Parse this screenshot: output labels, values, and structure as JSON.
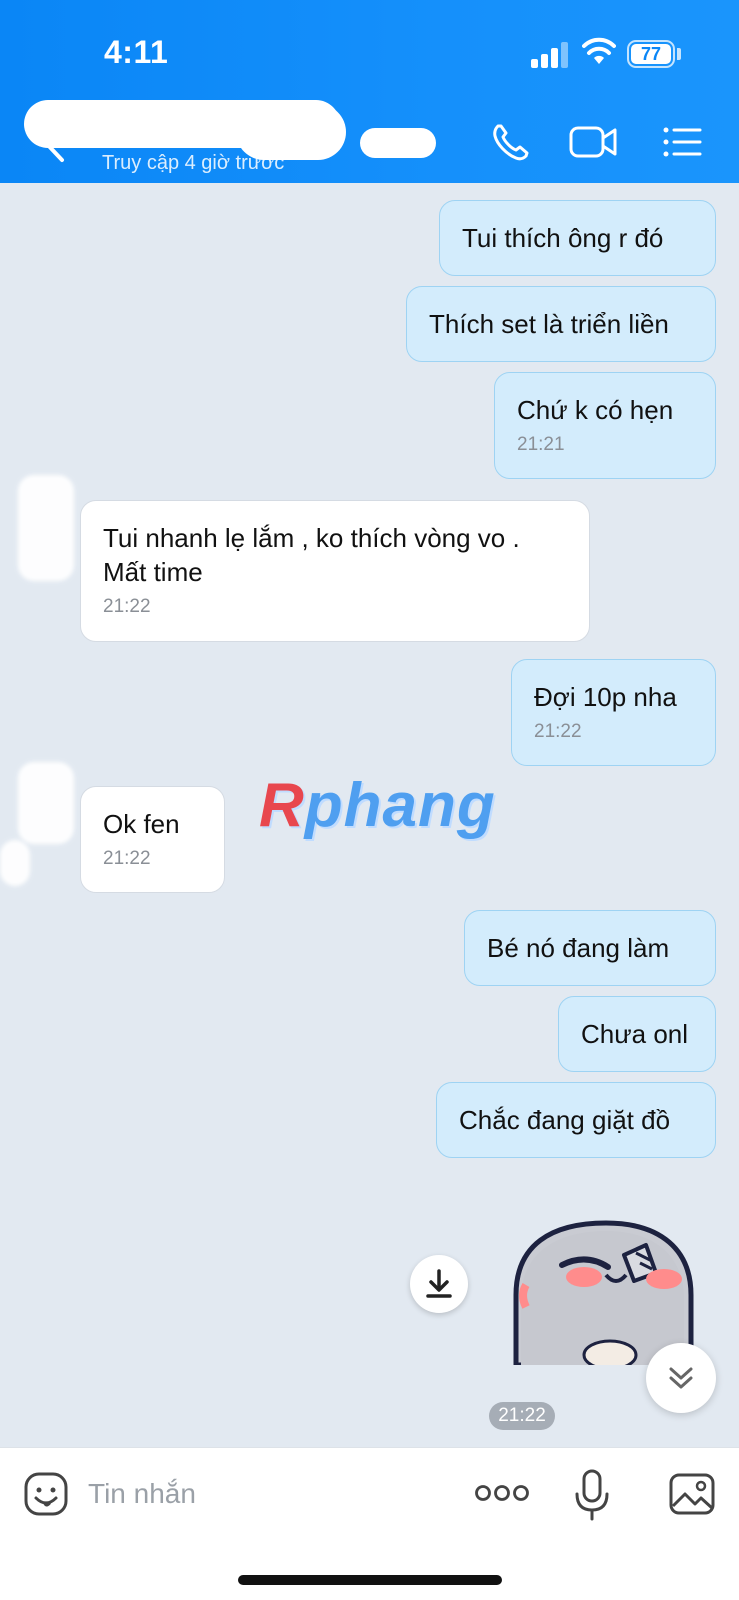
{
  "status_bar": {
    "time": "4:11",
    "battery": "77"
  },
  "header": {
    "last_seen": "Truy cập 4 giờ trước",
    "icons": [
      "back-chevron-icon",
      "phone-icon",
      "video-call-icon",
      "menu-list-icon"
    ]
  },
  "messages": [
    {
      "from": "me",
      "text": "Tui thích ông r đó",
      "time": ""
    },
    {
      "from": "me",
      "text": "Thích set là triển liền",
      "time": ""
    },
    {
      "from": "me",
      "text": "Chứ k có hẹn",
      "time": "21:21"
    },
    {
      "from": "them",
      "text": "Tui nhanh lẹ lắm , ko thích vòng vo .",
      "text2": "Mất time",
      "time": "21:22"
    },
    {
      "from": "me",
      "text": "Đợi 10p nha",
      "time": "21:22"
    },
    {
      "from": "them",
      "text": "Ok fen",
      "time": "21:22"
    },
    {
      "from": "me",
      "text": "Bé nó đang làm",
      "time": ""
    },
    {
      "from": "me",
      "text": "Chưa onl",
      "time": ""
    },
    {
      "from": "me",
      "text": "Chắc đang giặt đồ",
      "time": ""
    }
  ],
  "sticker": {
    "time": "21:22",
    "icon": "blushing-gray-character-sticker"
  },
  "watermark": {
    "first": "R",
    "rest": "phang"
  },
  "input_bar": {
    "placeholder": "Tin nhắn",
    "icons": [
      "emoji-icon",
      "more-dots-icon",
      "microphone-icon",
      "image-icon"
    ]
  },
  "colors": {
    "header": "#0a86f6",
    "my_bubble": "#d3ecfc",
    "their_bubble": "#ffffff",
    "chat_bg": "#e2e9f1"
  }
}
